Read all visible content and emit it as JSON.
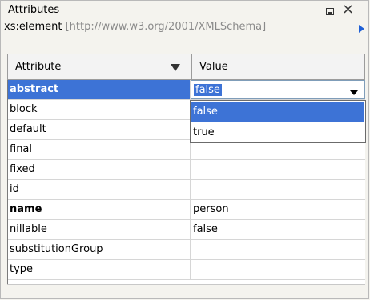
{
  "panel": {
    "title": "Attributes",
    "minimize_icon": "minimize-icon",
    "close_glyph": "×"
  },
  "context": {
    "element": "xs:element",
    "namespace": " [http://www.w3.org/2001/XMLSchema]"
  },
  "table": {
    "headers": {
      "attribute": "Attribute",
      "value": "Value"
    },
    "rows": [
      {
        "name": "abstract",
        "value": "false",
        "bold": true,
        "selected": true
      },
      {
        "name": "block",
        "value": ""
      },
      {
        "name": "default",
        "value": ""
      },
      {
        "name": "final",
        "value": ""
      },
      {
        "name": "fixed",
        "value": ""
      },
      {
        "name": "id",
        "value": ""
      },
      {
        "name": "name",
        "value": "person",
        "bold": true
      },
      {
        "name": "nillable",
        "value": "false"
      },
      {
        "name": "substitutionGroup",
        "value": ""
      },
      {
        "name": "type",
        "value": ""
      }
    ]
  },
  "dropdown": {
    "options": [
      "false",
      "true"
    ],
    "highlighted": "false"
  },
  "colors": {
    "selection": "#3d73d6",
    "namespace_text": "#8a8a8a",
    "arrow_accent": "#1e5fd6"
  }
}
